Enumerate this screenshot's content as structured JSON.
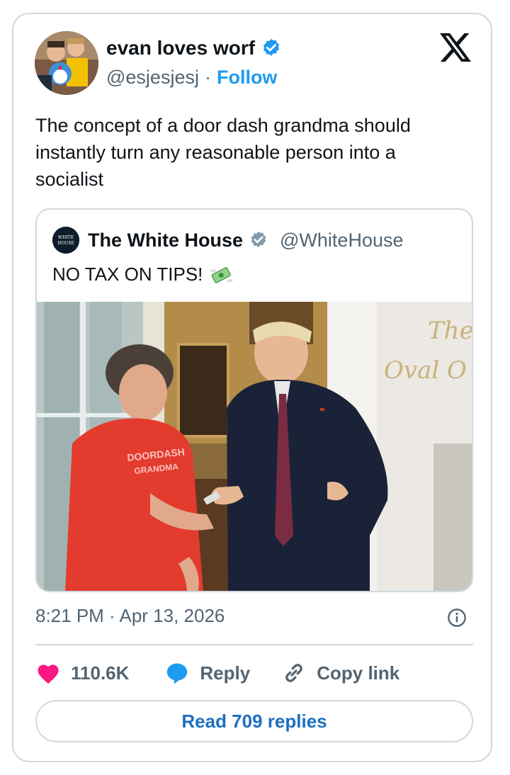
{
  "tweet": {
    "author_name": "evan loves worf",
    "author_handle": "@esjesjesj",
    "separator": "·",
    "follow_label": "Follow",
    "text": "The concept of a door dash grandma should instantly turn any reasonable person into a socialist",
    "timestamp": "8:21 PM · Apr 13, 2026"
  },
  "quoted": {
    "author_name": "The White House",
    "author_handle": "@WhiteHouse",
    "text": "NO TAX ON TIPS!",
    "text_emoji": "money-with-wings-icon",
    "photo": {
      "shirt_text_1": "DOORDASH",
      "shirt_text_2": "GRANDMA",
      "sign_text_1": "The",
      "sign_text_2": "Oval O"
    },
    "avatar_text_1": "WHITE",
    "avatar_text_2": "HOUSE"
  },
  "actions": {
    "likes": "110.6K",
    "reply_label": "Reply",
    "copy_link_label": "Copy link"
  },
  "read_replies_label": "Read 709 replies",
  "colors": {
    "like": "#f91880",
    "reply": "#1d9bf0",
    "link_blue": "#1d9bf0",
    "verified_blue": "#1d9bf0",
    "verified_gray": "#829aab",
    "border": "#cfd9de",
    "muted": "#536471"
  }
}
